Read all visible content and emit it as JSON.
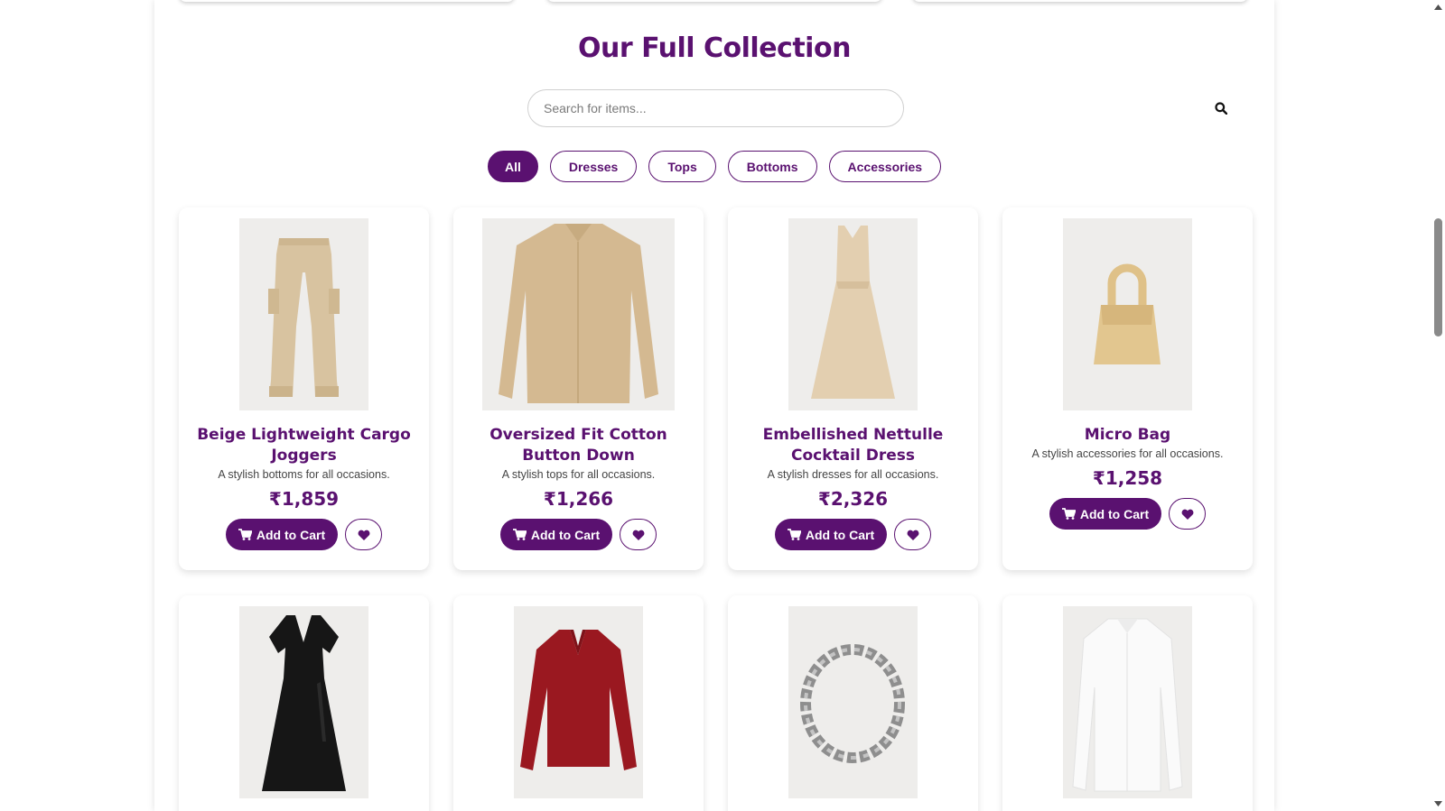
{
  "section": {
    "title": "Our Full Collection"
  },
  "search": {
    "placeholder": "Search for items..."
  },
  "filters": [
    {
      "label": "All",
      "active": true
    },
    {
      "label": "Dresses",
      "active": false
    },
    {
      "label": "Tops",
      "active": false
    },
    {
      "label": "Bottoms",
      "active": false
    },
    {
      "label": "Accessories",
      "active": false
    }
  ],
  "products": [
    {
      "name": "Beige Lightweight Cargo Joggers",
      "description": "A stylish bottoms for all occasions.",
      "price": "₹1,859",
      "add_label": "Add to Cart",
      "image": "beige-cargo-joggers",
      "color": "#d8c3a0"
    },
    {
      "name": "Oversized Fit Cotton Button Down",
      "description": "A stylish tops for all occasions.",
      "price": "₹1,266",
      "add_label": "Add to Cart",
      "image": "beige-button-down-shirt",
      "color": "#d4b991"
    },
    {
      "name": "Embellished Nettulle Cocktail Dress",
      "description": "A stylish dresses for all occasions.",
      "price": "₹2,326",
      "add_label": "Add to Cart",
      "image": "beige-tulle-dress",
      "color": "#e3cfb0"
    },
    {
      "name": "Micro Bag",
      "description": "A stylish accessories for all occasions.",
      "price": "₹1,258",
      "add_label": "Add to Cart",
      "image": "beige-micro-bag",
      "color": "#e2c68f"
    }
  ],
  "products_row2": [
    {
      "image": "black-wrap-dress",
      "color": "#161616"
    },
    {
      "image": "red-v-neck-top",
      "color": "#9a1820"
    },
    {
      "image": "silver-chain-necklace",
      "color": "#9a9a9a"
    },
    {
      "image": "white-shirt",
      "color": "#f7f7f7"
    }
  ],
  "colors": {
    "brand": "#5a1170",
    "image_bg": "#eeedeb"
  }
}
